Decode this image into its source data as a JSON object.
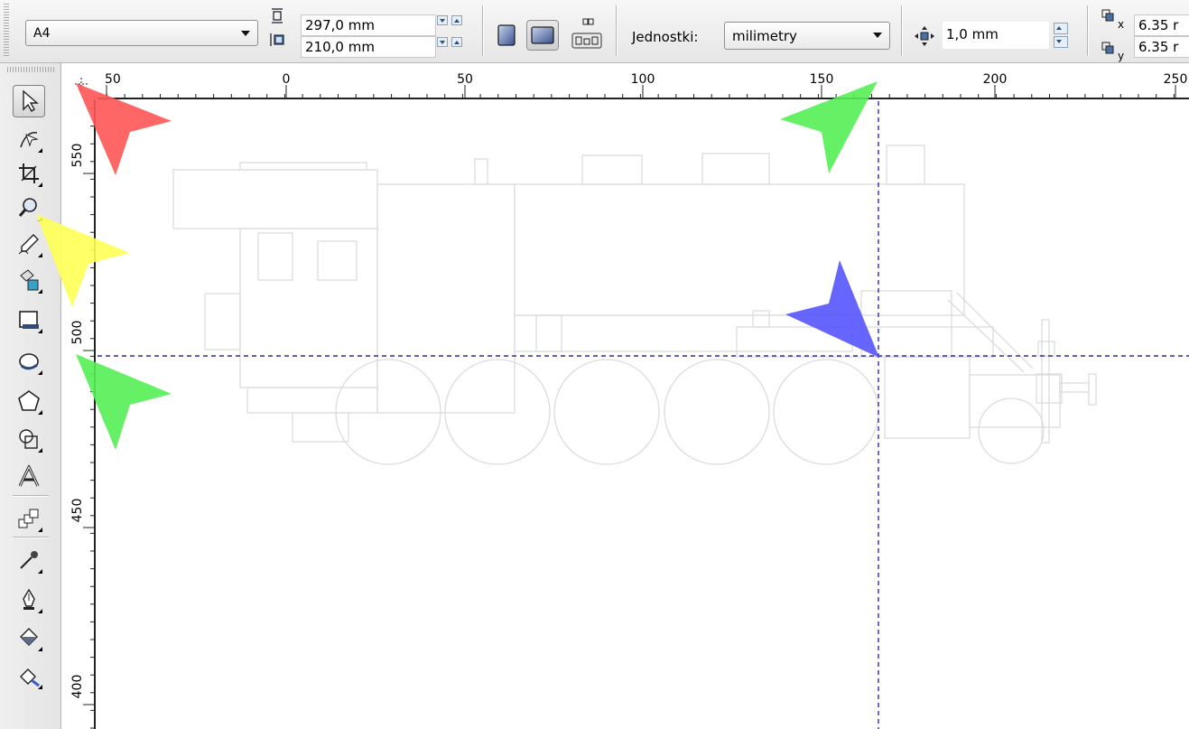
{
  "property_bar": {
    "page_size": "A4",
    "page_width": "297,0 mm",
    "page_height": "210,0 mm",
    "units_label": "Jednostki:",
    "units_value": "milimetry",
    "nudge_value": "1,0 mm",
    "duplicate_x": "6.35 r",
    "duplicate_y": "6.35 r",
    "dup_x_axis": "x",
    "dup_y_axis": "y"
  },
  "rulers": {
    "horizontal_ticks": [
      "50",
      "0",
      "50",
      "100",
      "150",
      "200",
      "250"
    ],
    "vertical_ticks": [
      "550",
      "500",
      "450",
      "400"
    ]
  },
  "toolbox": {
    "tools": [
      "pick-tool",
      "shape-tool",
      "crop-tool",
      "zoom-tool",
      "freehand-tool",
      "smart-fill-tool",
      "rectangle-tool",
      "ellipse-tool",
      "polygon-tool",
      "basic-shapes-tool",
      "text-tool",
      "interactive-blend-tool",
      "eyedropper-tool",
      "outline-pen-tool",
      "fill-tool",
      "interactive-fill-tool"
    ]
  },
  "markers": {
    "colors": {
      "red": "#ff5555",
      "yellow": "#ffff55",
      "green": "#55ee55",
      "blue": "#5555ff"
    }
  },
  "guides": {
    "color": "#2d2d9c"
  }
}
